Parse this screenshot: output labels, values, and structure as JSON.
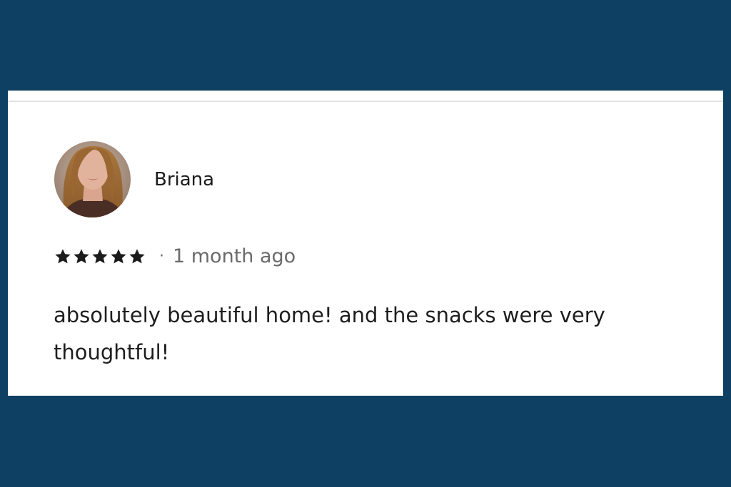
{
  "review": {
    "reviewer_name": "Briana",
    "avatar_icon": "user-photo-avatar",
    "rating": {
      "value": 5,
      "max": 5,
      "icon": "star-icon",
      "color": "#1b1b1b"
    },
    "separator": "·",
    "time_ago": "1 month ago",
    "text": "absolutely beautiful home! and the snacks were very thoughtful!"
  },
  "colors": {
    "background": "#0d4062",
    "card": "#ffffff",
    "text_primary": "#1e1e1e",
    "text_secondary": "#6a6a6a"
  }
}
